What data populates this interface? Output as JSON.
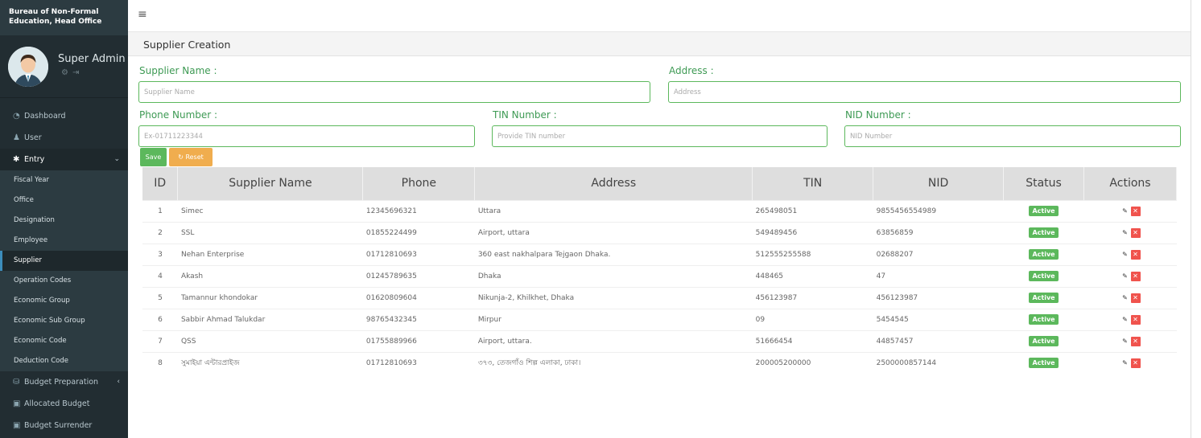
{
  "brand": {
    "line1": "Bureau of Non-Formal",
    "line2": "Education, Head Office"
  },
  "user": {
    "name": "Super Admin"
  },
  "menu": {
    "dashboard": "Dashboard",
    "user": "User",
    "entry": "Entry",
    "sub_items": [
      "Fiscal Year",
      "Office",
      "Designation",
      "Employee",
      "Supplier",
      "Operation Codes",
      "Economic Group",
      "Economic Sub Group",
      "Economic Code",
      "Deduction Code"
    ],
    "budget_preparation": "Budget Preparation",
    "allocated_budget": "Allocated Budget",
    "budget_surrender": "Budget Surrender",
    "active_item": "Supplier"
  },
  "page": {
    "title": "Supplier Creation"
  },
  "form": {
    "supplier_name": {
      "label": "Supplier Name :",
      "placeholder": "Supplier Name"
    },
    "address": {
      "label": "Address :",
      "placeholder": "Address"
    },
    "phone": {
      "label": "Phone Number :",
      "placeholder": "Ex-01711223344"
    },
    "tin": {
      "label": "TIN Number :",
      "placeholder": "Provide TIN number"
    },
    "nid": {
      "label": "NID Number :",
      "placeholder": "NID Number"
    },
    "save_label": "Save",
    "reset_label": "Reset"
  },
  "table": {
    "headers": [
      "ID",
      "Supplier Name",
      "Phone",
      "Address",
      "TIN",
      "NID",
      "Status",
      "Actions"
    ],
    "rows": [
      {
        "id": "1",
        "name": "Simec",
        "phone": "12345696321",
        "address": "Uttara",
        "tin": "265498051",
        "nid": "9855456554989",
        "status": "Active"
      },
      {
        "id": "2",
        "name": "SSL",
        "phone": "01855224499",
        "address": "Airport, uttara",
        "tin": "549489456",
        "nid": "63856859",
        "status": "Active"
      },
      {
        "id": "3",
        "name": "Nehan Enterprise",
        "phone": "01712810693",
        "address": "360 east nakhalpara Tejgaon Dhaka.",
        "tin": "512555255588",
        "nid": "02688207",
        "status": "Active"
      },
      {
        "id": "4",
        "name": "Akash",
        "phone": "01245789635",
        "address": "Dhaka",
        "tin": "448465",
        "nid": "47",
        "status": "Active"
      },
      {
        "id": "5",
        "name": "Tamannur khondokar",
        "phone": "01620809604",
        "address": "Nikunja-2, Khilkhet, Dhaka",
        "tin": "456123987",
        "nid": "456123987",
        "status": "Active"
      },
      {
        "id": "6",
        "name": "Sabbir Ahmad Talukdar",
        "phone": "98765432345",
        "address": "Mirpur",
        "tin": "09",
        "nid": "5454545",
        "status": "Active"
      },
      {
        "id": "7",
        "name": "QSS",
        "phone": "01755889966",
        "address": "Airport, uttara.",
        "tin": "51666454",
        "nid": "44857457",
        "status": "Active"
      },
      {
        "id": "8",
        "name": "সুমাইয়া এন্টারপ্রাইজ",
        "phone": "01712810693",
        "address": "৩৭৩, তেজগাঁও শিল্প এলাকা, ঢাকা।",
        "tin": "200005200000",
        "nid": "2500000857144",
        "status": "Active"
      }
    ]
  },
  "colors": {
    "sidebar": "#222d32",
    "accent_green": "#5cb85c",
    "reset_orange": "#f0ad4e",
    "delete_red": "#f0534d"
  }
}
